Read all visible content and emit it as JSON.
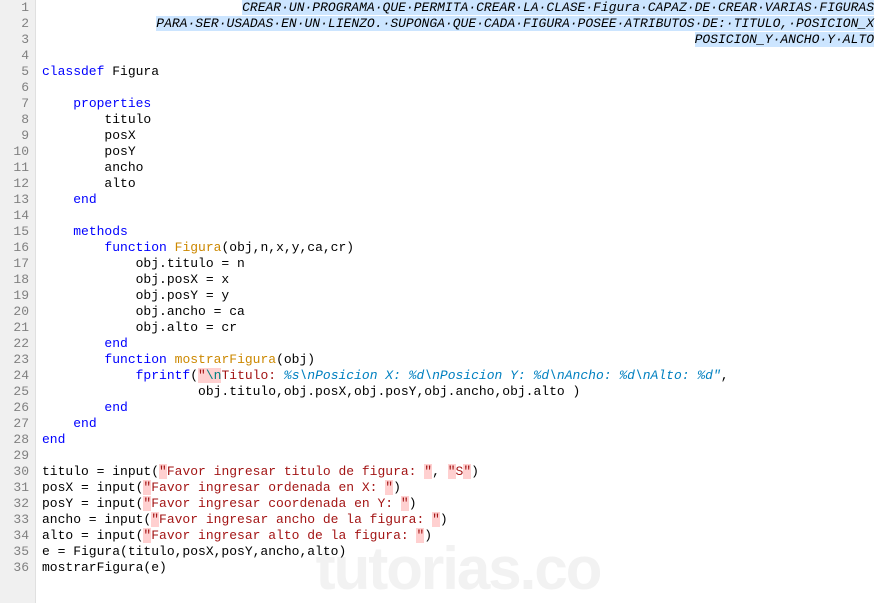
{
  "watermark": "tutorias.co",
  "lines": [
    {
      "n": 1,
      "type": "hlcomment-right",
      "text": "CREAR UN PROGRAMA QUE PERMITA CREAR LA CLASE Figura CAPAZ DE CREAR VARIAS FIGURAS"
    },
    {
      "n": 2,
      "type": "hlcomment-right",
      "text": "PARA SER USADAS EN UN LIENZO. SUPONGA QUE CADA FIGURA POSEE ATRIBUTOS DE: TITULO, POSICION_X"
    },
    {
      "n": 3,
      "type": "hlcomment-right",
      "text": "POSICION_Y ANCHO Y ALTO"
    },
    {
      "n": 4,
      "type": "plain",
      "segs": []
    },
    {
      "n": 5,
      "type": "plain",
      "segs": [
        {
          "c": "kw",
          "t": "classdef"
        },
        {
          "c": "",
          "t": " Figura"
        }
      ]
    },
    {
      "n": 6,
      "type": "plain",
      "segs": []
    },
    {
      "n": 7,
      "type": "plain",
      "segs": [
        {
          "c": "",
          "t": "    "
        },
        {
          "c": "kw",
          "t": "properties"
        }
      ]
    },
    {
      "n": 8,
      "type": "plain",
      "segs": [
        {
          "c": "",
          "t": "        titulo"
        }
      ]
    },
    {
      "n": 9,
      "type": "plain",
      "segs": [
        {
          "c": "",
          "t": "        posX"
        }
      ]
    },
    {
      "n": 10,
      "type": "plain",
      "segs": [
        {
          "c": "",
          "t": "        posY"
        }
      ]
    },
    {
      "n": 11,
      "type": "plain",
      "segs": [
        {
          "c": "",
          "t": "        ancho"
        }
      ]
    },
    {
      "n": 12,
      "type": "plain",
      "segs": [
        {
          "c": "",
          "t": "        alto"
        }
      ]
    },
    {
      "n": 13,
      "type": "plain",
      "segs": [
        {
          "c": "",
          "t": "    "
        },
        {
          "c": "kw",
          "t": "end"
        }
      ]
    },
    {
      "n": 14,
      "type": "plain",
      "segs": []
    },
    {
      "n": 15,
      "type": "plain",
      "segs": [
        {
          "c": "",
          "t": "    "
        },
        {
          "c": "kw",
          "t": "methods"
        }
      ]
    },
    {
      "n": 16,
      "type": "plain",
      "segs": [
        {
          "c": "",
          "t": "        "
        },
        {
          "c": "kw",
          "t": "function"
        },
        {
          "c": "",
          "t": " "
        },
        {
          "c": "fn",
          "t": "Figura"
        },
        {
          "c": "",
          "t": "(obj,n,x,y,ca,cr)"
        }
      ]
    },
    {
      "n": 17,
      "type": "plain",
      "segs": [
        {
          "c": "",
          "t": "            obj.titulo = n"
        }
      ]
    },
    {
      "n": 18,
      "type": "plain",
      "segs": [
        {
          "c": "",
          "t": "            obj.posX = x"
        }
      ]
    },
    {
      "n": 19,
      "type": "plain",
      "segs": [
        {
          "c": "",
          "t": "            obj.posY = y"
        }
      ]
    },
    {
      "n": 20,
      "type": "plain",
      "segs": [
        {
          "c": "",
          "t": "            obj.ancho = ca"
        }
      ]
    },
    {
      "n": 21,
      "type": "plain",
      "segs": [
        {
          "c": "",
          "t": "            obj.alto = cr"
        }
      ]
    },
    {
      "n": 22,
      "type": "plain",
      "segs": [
        {
          "c": "",
          "t": "        "
        },
        {
          "c": "kw",
          "t": "end"
        }
      ]
    },
    {
      "n": 23,
      "type": "plain",
      "segs": [
        {
          "c": "",
          "t": "        "
        },
        {
          "c": "kw",
          "t": "function"
        },
        {
          "c": "",
          "t": " "
        },
        {
          "c": "fn",
          "t": "mostrarFigura"
        },
        {
          "c": "",
          "t": "(obj)"
        }
      ]
    },
    {
      "n": 24,
      "type": "plain",
      "segs": [
        {
          "c": "",
          "t": "            "
        },
        {
          "c": "kw",
          "t": "fprintf"
        },
        {
          "c": "",
          "t": "("
        },
        {
          "c": "str-hl",
          "t": "\""
        },
        {
          "c": "esc",
          "t": "\\n"
        },
        {
          "c": "str",
          "t": "Titulo: "
        },
        {
          "c": "fmt",
          "t": "%s\\nPosicion X: %d\\nPosicion Y: %d\\nAncho: %d\\nAlto: %d\""
        },
        {
          "c": "",
          "t": ","
        }
      ]
    },
    {
      "n": 25,
      "type": "plain",
      "segs": [
        {
          "c": "",
          "t": "                    obj.titulo,obj.posX,obj.posY,obj.ancho,obj.alto )"
        }
      ]
    },
    {
      "n": 26,
      "type": "plain",
      "segs": [
        {
          "c": "",
          "t": "        "
        },
        {
          "c": "kw",
          "t": "end"
        }
      ]
    },
    {
      "n": 27,
      "type": "plain",
      "segs": [
        {
          "c": "",
          "t": "    "
        },
        {
          "c": "kw",
          "t": "end"
        }
      ]
    },
    {
      "n": 28,
      "type": "plain",
      "segs": [
        {
          "c": "kw",
          "t": "end"
        }
      ]
    },
    {
      "n": 29,
      "type": "plain",
      "segs": []
    },
    {
      "n": 30,
      "type": "plain",
      "segs": [
        {
          "c": "",
          "t": "titulo = input("
        },
        {
          "c": "str-hl",
          "t": "\""
        },
        {
          "c": "str",
          "t": "Favor ingresar titulo de figura: "
        },
        {
          "c": "str-hl",
          "t": "\""
        },
        {
          "c": "",
          "t": ", "
        },
        {
          "c": "str-hl",
          "t": "\""
        },
        {
          "c": "str",
          "t": "S"
        },
        {
          "c": "str-hl",
          "t": "\""
        },
        {
          "c": "",
          "t": ")"
        }
      ]
    },
    {
      "n": 31,
      "type": "plain",
      "segs": [
        {
          "c": "",
          "t": "posX = input("
        },
        {
          "c": "str-hl",
          "t": "\""
        },
        {
          "c": "str",
          "t": "Favor ingresar ordenada en X: "
        },
        {
          "c": "str-hl",
          "t": "\""
        },
        {
          "c": "",
          "t": ")"
        }
      ]
    },
    {
      "n": 32,
      "type": "plain",
      "segs": [
        {
          "c": "",
          "t": "posY = input("
        },
        {
          "c": "str-hl",
          "t": "\""
        },
        {
          "c": "str",
          "t": "Favor ingresar coordenada en Y: "
        },
        {
          "c": "str-hl",
          "t": "\""
        },
        {
          "c": "",
          "t": ")"
        }
      ]
    },
    {
      "n": 33,
      "type": "plain",
      "segs": [
        {
          "c": "",
          "t": "ancho = input("
        },
        {
          "c": "str-hl",
          "t": "\""
        },
        {
          "c": "str",
          "t": "Favor ingresar ancho de la figura: "
        },
        {
          "c": "str-hl",
          "t": "\""
        },
        {
          "c": "",
          "t": ")"
        }
      ]
    },
    {
      "n": 34,
      "type": "plain",
      "segs": [
        {
          "c": "",
          "t": "alto = input("
        },
        {
          "c": "str-hl",
          "t": "\""
        },
        {
          "c": "str",
          "t": "Favor ingresar alto de la figura: "
        },
        {
          "c": "str-hl",
          "t": "\""
        },
        {
          "c": "",
          "t": ")"
        }
      ]
    },
    {
      "n": 35,
      "type": "plain",
      "segs": [
        {
          "c": "",
          "t": "e = Figura(titulo,posX,posY,ancho,alto)"
        }
      ]
    },
    {
      "n": 36,
      "type": "plain",
      "segs": [
        {
          "c": "",
          "t": "mostrarFigura(e)"
        }
      ]
    }
  ]
}
